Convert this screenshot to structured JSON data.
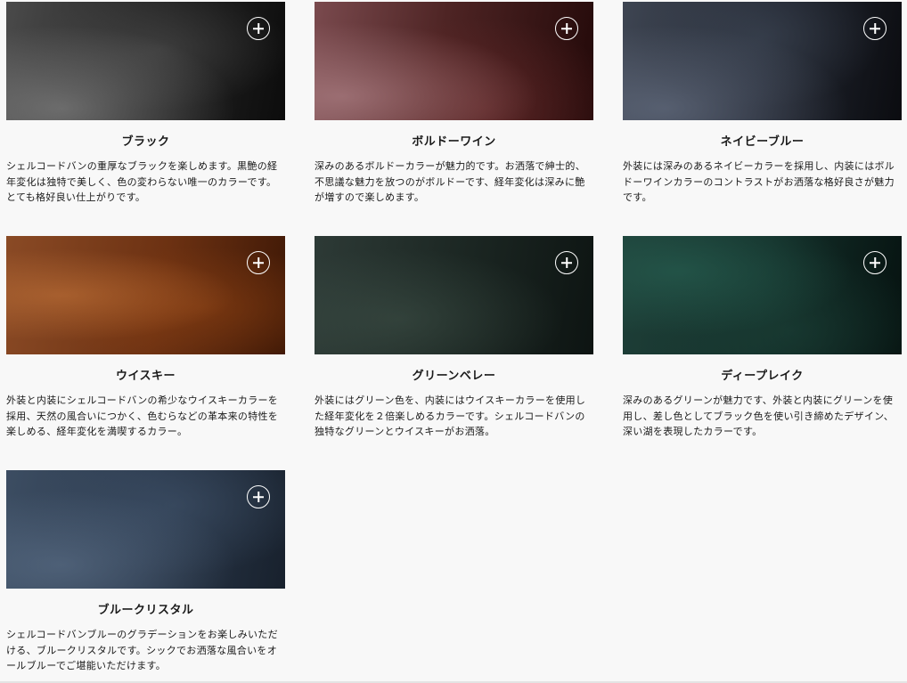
{
  "colors": [
    {
      "name": "ブラック",
      "description": "シェルコードバンの重厚なブラックを楽しめます。黒艶の経年変化は独特で美しく、色の変わらない唯一のカラーです。とても格好良い仕上がりです。",
      "swatch_color": "#2a2a2a"
    },
    {
      "name": "ボルドーワイン",
      "description": "深みのあるボルドーカラーが魅力的です。お洒落で紳士的、不思議な魅力を放つのがボルドーです、経年変化は深みに艶が増すので楽しめます。",
      "swatch_color": "#4e2424"
    },
    {
      "name": "ネイビーブルー",
      "description": "外装には深みのあるネイビーカラーを採用し、内装にはボルドーワインカラーのコントラストがお洒落な格好良さが魅力です。",
      "swatch_color": "#232833"
    },
    {
      "name": "ウイスキー",
      "description": "外装と内装にシェルコードバンの希少なウイスキーカラーを採用、天然の風合いにつかく、色むらなどの革本来の特性を楽しめる、経年変化を満喫するカラー。",
      "swatch_color": "#6c3112"
    },
    {
      "name": "グリーンベレー",
      "description": "外装にはグリーン色を、内装にはウイスキーカラーを使用した経年変化を２倍楽しめるカラーです。シェルコードバンの独特なグリーンとウイスキーがお洒落。",
      "swatch_color": "#1c2723"
    },
    {
      "name": "ディープレイク",
      "description": "深みのあるグリーンが魅力です、外装と内装にグリーンを使用し、差し色としてブラック色を使い引き締めたデザイン、深い湖を表現したカラーです。",
      "swatch_color": "#14302a"
    },
    {
      "name": "ブルークリスタル",
      "description": "シェルコードバンブルーのグラデーションをお楽しみいただける、ブルークリスタルです。シックでお洒落な風合いをオールブルーでご堪能いただけます。",
      "swatch_color": "#2b394c"
    }
  ],
  "icons": {
    "expand": "plus-circle-icon"
  }
}
